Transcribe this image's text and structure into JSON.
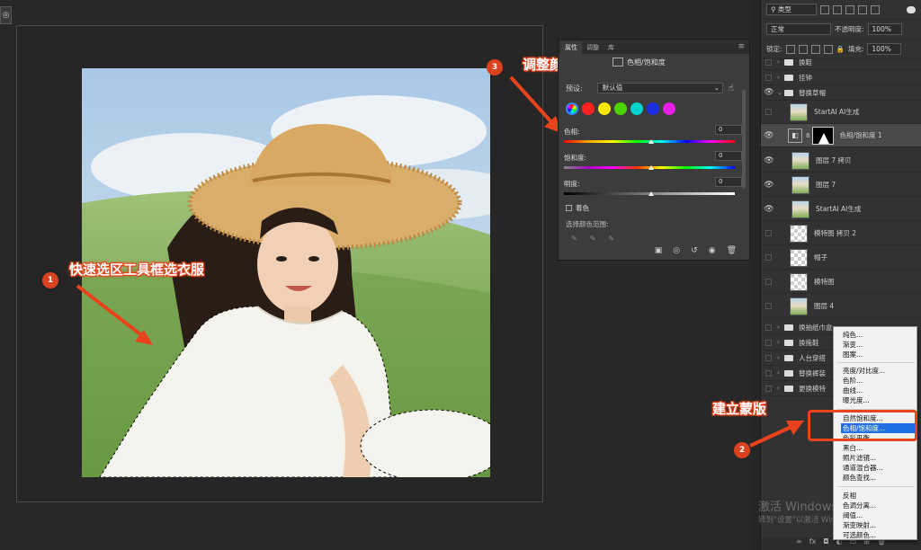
{
  "tool_corner": "◎",
  "properties_panel": {
    "tabs": [
      "属性",
      "调整",
      "库"
    ],
    "title": "色相/饱和度",
    "preset_label": "预设:",
    "preset_value": "默认值",
    "swatch_colors": [
      "#ff2020",
      "#ffe600",
      "#4cd400",
      "#00d4d0",
      "#1c2fe0",
      "#e61ee6"
    ],
    "hue_label": "色相:",
    "hue_value": "0",
    "saturation_label": "饱和度:",
    "saturation_value": "0",
    "lightness_label": "明度:",
    "lightness_value": "0",
    "colorize_label": "着色",
    "color_range_label": "选择颜色范围:"
  },
  "annotations": {
    "step1_num": "1",
    "step1_text": "快速选区工具框选衣服",
    "step2_num": "2",
    "step2_text": "建立蒙版",
    "step3_num": "3",
    "step3_text": "调整颜色",
    "accent_color": "#e8431c"
  },
  "layers_panel": {
    "kind_filter": "类型",
    "blend_mode": "正常",
    "opacity_label": "不透明度:",
    "opacity_value": "100%",
    "lock_label": "锁定:",
    "fill_label": "填充:",
    "fill_value": "100%",
    "layers": [
      {
        "name": "换鞋"
      },
      {
        "name": "挂钟"
      },
      {
        "name": "替换草帽"
      },
      {
        "name": "StartAI AI生成"
      },
      {
        "name": "色相/饱和度 1"
      },
      {
        "name": "图层 7 拷贝"
      },
      {
        "name": "图层 7"
      },
      {
        "name": "StartAI AI生成"
      },
      {
        "name": "模特图 拷贝 2"
      },
      {
        "name": "帽子"
      },
      {
        "name": "模特图"
      },
      {
        "name": "图层 4"
      },
      {
        "name": "换抽纸巾盒"
      },
      {
        "name": "换拖鞋"
      },
      {
        "name": "人台穿搭"
      },
      {
        "name": "替换裤装"
      },
      {
        "name": "更换模特"
      }
    ]
  },
  "adjustment_menu": {
    "items": [
      "纯色...",
      "渐变...",
      "图案...",
      "亮度/对比度...",
      "色阶...",
      "曲线...",
      "曝光度...",
      "自然饱和度...",
      "色相/饱和度...",
      "色彩平衡...",
      "黑白...",
      "照片滤镜...",
      "通道混合器...",
      "颜色查找...",
      "反相",
      "色调分离...",
      "阈值...",
      "渐变映射...",
      "可选颜色..."
    ],
    "highlighted": "色相/饱和度..."
  },
  "watermark": {
    "line1": "激活 Windows",
    "line2": "转到\"设置\"以激活 Windows。"
  }
}
